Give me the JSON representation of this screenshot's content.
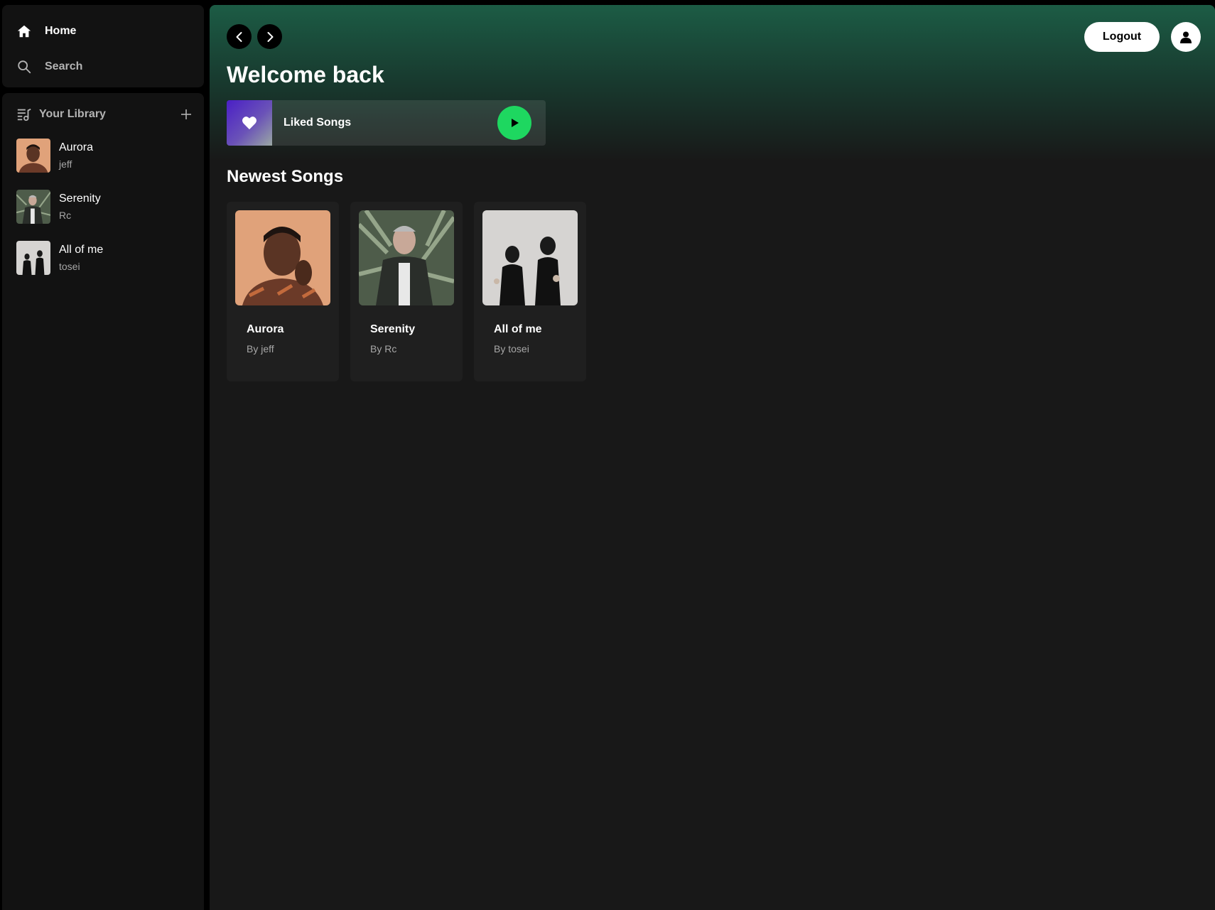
{
  "sidebar": {
    "nav": [
      {
        "label": "Home",
        "icon": "home-icon"
      },
      {
        "label": "Search",
        "icon": "search-icon"
      }
    ]
  },
  "library": {
    "title": "Your Library",
    "items": [
      {
        "name": "Aurora",
        "artist": "jeff"
      },
      {
        "name": "Serenity",
        "artist": "Rc"
      },
      {
        "name": "All of me",
        "artist": "tosei"
      }
    ]
  },
  "header": {
    "logout_label": "Logout",
    "page_title": "Welcome back"
  },
  "liked": {
    "label": "Liked Songs"
  },
  "newest": {
    "title": "Newest Songs",
    "songs": [
      {
        "name": "Aurora",
        "by": "By jeff"
      },
      {
        "name": "Serenity",
        "by": "By Rc"
      },
      {
        "name": "All of me",
        "by": "By tosei"
      }
    ]
  },
  "colors": {
    "accent": "#1ed760",
    "header_gradient": "#1c5c45",
    "background": "#181818"
  }
}
